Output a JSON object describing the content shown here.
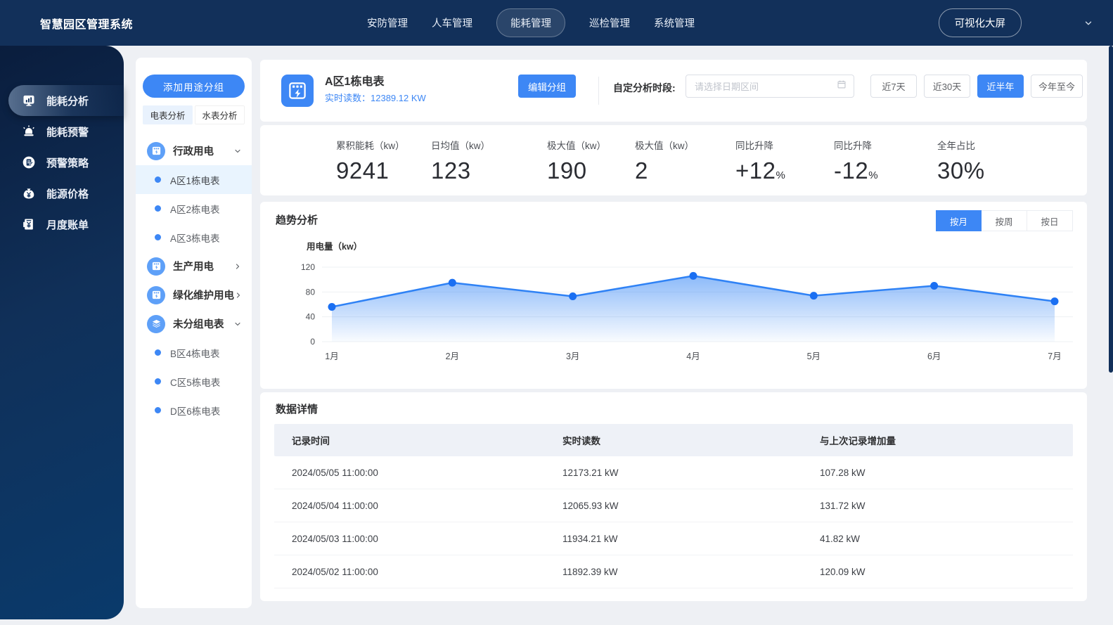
{
  "navbar": {
    "title": "智慧园区管理系统",
    "items": [
      {
        "label": "安防管理",
        "active": false
      },
      {
        "label": "人车管理",
        "active": false
      },
      {
        "label": "能耗管理",
        "active": true
      },
      {
        "label": "巡检管理",
        "active": false
      },
      {
        "label": "系统管理",
        "active": false
      }
    ],
    "screen_button": "可视化大屏"
  },
  "sidebar": {
    "items": [
      {
        "label": "能耗分析",
        "icon": "bar-chart-board-icon",
        "active": true
      },
      {
        "label": "能耗预警",
        "icon": "alarm-siren-icon",
        "active": false
      },
      {
        "label": "预警策略",
        "icon": "strategy-doc-icon",
        "active": false
      },
      {
        "label": "能源价格",
        "icon": "money-bag-icon",
        "active": false
      },
      {
        "label": "月度账单",
        "icon": "bill-icon",
        "active": false
      }
    ]
  },
  "meter_panel": {
    "add_group_button": "添加用途分组",
    "tabs": [
      {
        "label": "电表分析",
        "active": true
      },
      {
        "label": "水表分析",
        "active": false
      }
    ],
    "groups": [
      {
        "label": "行政用电",
        "icon": "electric-meter-icon",
        "expanded": true
      },
      {
        "label": "生产用电",
        "icon": "electric-meter-icon",
        "expanded": false
      },
      {
        "label": "绿化维护用电",
        "icon": "electric-meter-icon",
        "expanded": false
      },
      {
        "label": "未分组电表",
        "icon": "layers-icon",
        "expanded": true
      }
    ],
    "meters_admin": [
      {
        "label": "A区1栋电表",
        "selected": true
      },
      {
        "label": "A区2栋电表",
        "selected": false
      },
      {
        "label": "A区3栋电表",
        "selected": false
      }
    ],
    "meters_ungrouped": [
      {
        "label": "B区4栋电表",
        "selected": false
      },
      {
        "label": "C区5栋电表",
        "selected": false
      },
      {
        "label": "D区6栋电表",
        "selected": false
      }
    ]
  },
  "header": {
    "meter_name": "A区1栋电表",
    "reading_label": "实时读数：",
    "reading_value": "12389.12 KW",
    "edit_button": "编辑分组",
    "period_label": "自定分析时段:",
    "date_placeholder": "请选择日期区间",
    "range_buttons": [
      {
        "label": "近7天",
        "active": false
      },
      {
        "label": "近30天",
        "active": false
      },
      {
        "label": "近半年",
        "active": true
      },
      {
        "label": "今年至今",
        "active": false
      }
    ]
  },
  "stats": [
    {
      "label": "累积能耗（kw）",
      "value": "9241",
      "suffix": ""
    },
    {
      "label": "日均值（kw）",
      "value": "123",
      "suffix": ""
    },
    {
      "label": "极大值（kw）",
      "value": "190",
      "suffix": ""
    },
    {
      "label": "极大值（kw）",
      "value": "2",
      "suffix": ""
    },
    {
      "label": "同比升降",
      "value": "+12",
      "suffix": "%"
    },
    {
      "label": "同比升降",
      "value": "-12",
      "suffix": "%"
    },
    {
      "label": "全年占比",
      "value": "30%",
      "suffix": ""
    }
  ],
  "trend": {
    "title": "趋势分析",
    "tabs": [
      {
        "label": "按月",
        "active": true
      },
      {
        "label": "按周",
        "active": false
      },
      {
        "label": "按日",
        "active": false
      }
    ]
  },
  "chart_data": {
    "type": "area",
    "title": "趋势分析",
    "ylabel": "用电量（kw）",
    "x": [
      "1月",
      "2月",
      "3月",
      "4月",
      "5月",
      "6月",
      "7月"
    ],
    "series": [
      {
        "name": "用电量",
        "values": [
          56,
          95,
          73,
          106,
          74,
          90,
          65
        ]
      }
    ],
    "ylim": [
      0,
      120
    ],
    "yticks": [
      0,
      40,
      80,
      120
    ],
    "grid": true,
    "line_color": "#2f82f5",
    "dot_color": "#1a6ff2"
  },
  "table": {
    "title": "数据详情",
    "columns": [
      "记录时间",
      "实时读数",
      "与上次记录增加量"
    ],
    "rows": [
      [
        "2024/05/05 11:00:00",
        "12173.21 kW",
        "107.28 kW"
      ],
      [
        "2024/05/04 11:00:00",
        "12065.93 kW",
        "131.72 kW"
      ],
      [
        "2024/05/03 11:00:00",
        "11934.21 kW",
        "41.82 kW"
      ],
      [
        "2024/05/02 11:00:00",
        "11892.39 kW",
        "120.09 kW"
      ]
    ]
  },
  "icons": {
    "navbar_dropdown": "chevron-down",
    "date_input": "calendar",
    "group_expanded": "chevron-down",
    "group_collapsed": "chevron-right"
  }
}
